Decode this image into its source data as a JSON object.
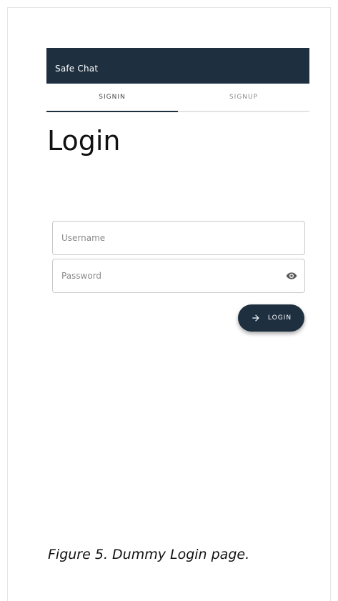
{
  "app": {
    "title": "Safe Chat"
  },
  "tabs": [
    {
      "label": "SIGNIN",
      "active": true
    },
    {
      "label": "SIGNUP",
      "active": false
    }
  ],
  "page": {
    "title": "Login"
  },
  "form": {
    "username": {
      "placeholder": "Username",
      "value": ""
    },
    "password": {
      "placeholder": "Password",
      "value": ""
    },
    "login_label": "LOGIN"
  },
  "caption": "Figure 5. Dummy Login page.",
  "icons": {
    "password_toggle": "eye-icon",
    "login_button": "arrow-right-icon"
  },
  "colors": {
    "primary": "#1e3040",
    "background": "#ffffff",
    "tab_inactive": "#8a8a8a",
    "field_border": "#c9c9c9"
  }
}
